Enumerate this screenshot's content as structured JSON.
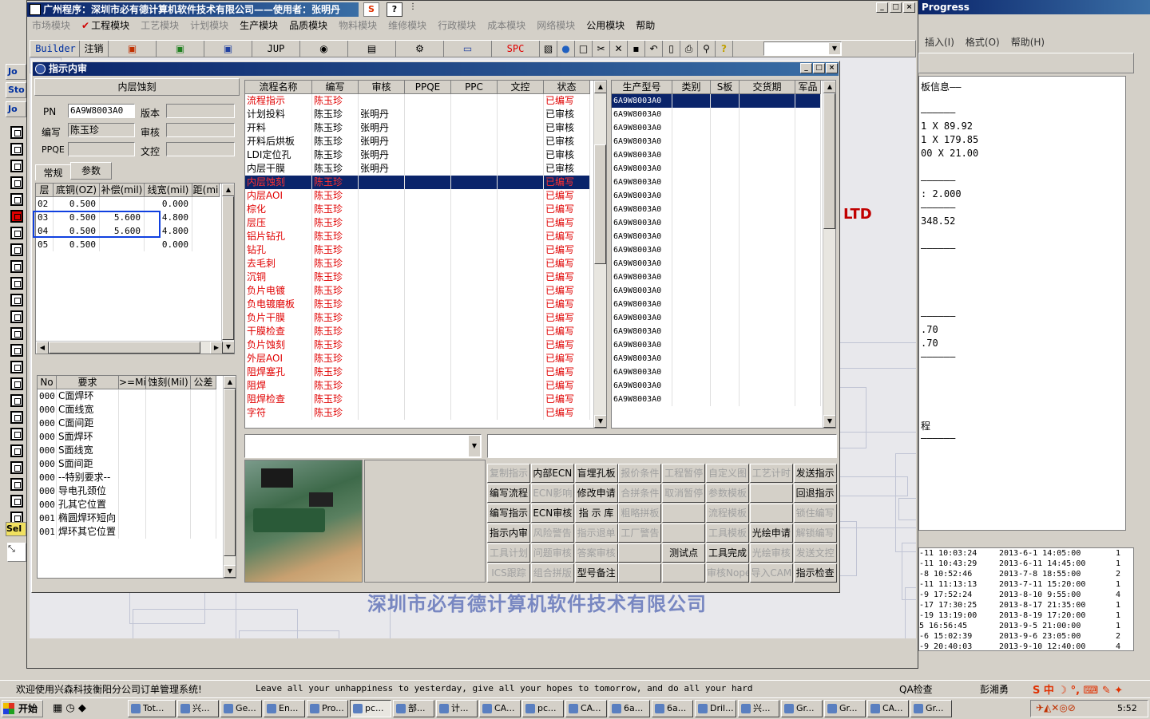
{
  "bg_app": {
    "title": "Progress",
    "menu": [
      "插入(I)",
      "格式(O)",
      "帮助(H)"
    ],
    "doc_lines": [
      "板信息——",
      "",
      "——————",
      "1 X 89.92",
      "1 X 179.85",
      "00 X 21.00",
      "",
      "——————",
      ": 2.000",
      "——————",
      "348.52",
      "",
      "——————",
      "",
      "",
      "",
      "",
      "——————",
      ".70",
      ".70",
      "——————",
      "",
      "",
      "",
      "",
      "程",
      "——————"
    ],
    "table_rows": [
      [
        "-11 10:03:24",
        "2013-6-1 14:05:00",
        "1"
      ],
      [
        "-11 10:43:29",
        "2013-6-11 14:45:00",
        "1"
      ],
      [
        "-8 10:52:46",
        "2013-7-8 18:55:00",
        "2"
      ],
      [
        "-11 11:13:13",
        "2013-7-11 15:20:00",
        "1"
      ],
      [
        "-9 17:52:24",
        "2013-8-10 9:55:00",
        "4"
      ],
      [
        "-17 17:30:25",
        "2013-8-17 21:35:00",
        "1"
      ],
      [
        "-19 13:19:00",
        "2013-8-19 17:20:00",
        "1"
      ],
      [
        "5 16:56:45",
        "2013-9-5 21:00:00",
        "1"
      ],
      [
        "-6 15:02:39",
        "2013-9-6 23:05:00",
        "2"
      ],
      [
        "-9 20:40:03",
        "2013-9-10 12:40:00",
        "4"
      ]
    ]
  },
  "main": {
    "title": "广州程序：深圳市必有德计算机软件技术有限公司——使用者：张明丹",
    "menu": [
      "市场模块",
      "工程模块",
      "工艺模块",
      "计划模块",
      "生产模块",
      "品质模块",
      "物料模块",
      "维修模块",
      "行政模块",
      "成本模块",
      "网络模块",
      "公用模块",
      "帮助"
    ],
    "toolbar": {
      "builder": "Builder",
      "logout": "注销",
      "jup": "JUP",
      "spc": "SPC"
    },
    "company": "深圳市必有德计算机软件技术有限公司",
    "ltd": "LTD"
  },
  "left_strip": [
    "Jo",
    "Sto",
    "Jo",
    "Sel"
  ],
  "dialog": {
    "title": "指示内审",
    "section": "内层蚀刻",
    "pn_label": "PN",
    "pn": "6A9W8003A0",
    "version_label": "版本",
    "writer_label": "编写",
    "writer": "陈玉珍",
    "reviewer_label": "审核",
    "ppqe_label": "PPQE",
    "doc_label": "文控",
    "tabs": [
      "常规",
      "参数"
    ],
    "layer_headers": [
      "层",
      "底铜(OZ)",
      "补偿(mil)",
      "线宽(mil)",
      "距(mi"
    ],
    "layers": [
      [
        "02",
        "0.500",
        "",
        "0.000"
      ],
      [
        "03",
        "0.500",
        "5.600",
        "4.800"
      ],
      [
        "04",
        "0.500",
        "5.600",
        "4.800"
      ],
      [
        "05",
        "0.500",
        "",
        "0.000"
      ]
    ],
    "req_headers": [
      "No",
      "要求",
      ">=Mil",
      "蚀刻(Mil)",
      "公差"
    ],
    "reqs": [
      [
        "000",
        "C面焊环"
      ],
      [
        "000",
        "C面线宽"
      ],
      [
        "000",
        "C面间距"
      ],
      [
        "000",
        "S面焊环"
      ],
      [
        "000",
        "S面线宽"
      ],
      [
        "000",
        "S面间距"
      ],
      [
        "000",
        "--特别要求--"
      ],
      [
        "000",
        "导电孔颈位"
      ],
      [
        "000",
        "孔其它位置"
      ],
      [
        "001",
        "椭圆焊环短向"
      ],
      [
        "001",
        "焊环其它位置"
      ]
    ],
    "flow_headers": [
      "流程名称",
      "编写",
      "审核",
      "PPQE",
      "PPC",
      "文控",
      "状态"
    ],
    "flows": [
      [
        "流程指示",
        "陈玉珍",
        "",
        "已编写",
        "red"
      ],
      [
        "计划投料",
        "陈玉珍",
        "张明丹",
        "已审核",
        ""
      ],
      [
        "开料",
        "陈玉珍",
        "张明丹",
        "已审核",
        ""
      ],
      [
        "开料后烘板",
        "陈玉珍",
        "张明丹",
        "已审核",
        ""
      ],
      [
        "LDI定位孔",
        "陈玉珍",
        "张明丹",
        "已审核",
        ""
      ],
      [
        "内层干膜",
        "陈玉珍",
        "张明丹",
        "已审核",
        ""
      ],
      [
        "内层蚀刻",
        "陈玉珍",
        "",
        "已编写",
        "sel"
      ],
      [
        "内层AOI",
        "陈玉珍",
        "",
        "已编写",
        "red"
      ],
      [
        "棕化",
        "陈玉珍",
        "",
        "已编写",
        "red"
      ],
      [
        "层压",
        "陈玉珍",
        "",
        "已编写",
        "red"
      ],
      [
        "铝片钻孔",
        "陈玉珍",
        "",
        "已编写",
        "red"
      ],
      [
        "钻孔",
        "陈玉珍",
        "",
        "已编写",
        "red"
      ],
      [
        "去毛刺",
        "陈玉珍",
        "",
        "已编写",
        "red"
      ],
      [
        "沉铜",
        "陈玉珍",
        "",
        "已编写",
        "red"
      ],
      [
        "负片电镀",
        "陈玉珍",
        "",
        "已编写",
        "red"
      ],
      [
        "负电镀磨板",
        "陈玉珍",
        "",
        "已编写",
        "red"
      ],
      [
        "负片干膜",
        "陈玉珍",
        "",
        "已编写",
        "red"
      ],
      [
        "干膜检查",
        "陈玉珍",
        "",
        "已编写",
        "red"
      ],
      [
        "负片蚀刻",
        "陈玉珍",
        "",
        "已编写",
        "red"
      ],
      [
        "外层AOI",
        "陈玉珍",
        "",
        "已编写",
        "red"
      ],
      [
        "阻焊塞孔",
        "陈玉珍",
        "",
        "已编写",
        "red"
      ],
      [
        "阻焊",
        "陈玉珍",
        "",
        "已编写",
        "red"
      ],
      [
        "阻焊检查",
        "陈玉珍",
        "",
        "已编写",
        "red"
      ],
      [
        "字符",
        "陈玉珍",
        "",
        "已编写",
        "red"
      ]
    ],
    "model_headers": [
      "生产型号",
      "类别",
      "S板",
      "交货期",
      "军品"
    ],
    "model_value": "6A9W8003A0",
    "model_rows": 23,
    "buttons": [
      [
        "复制指示",
        "内部ECN",
        "盲埋孔板",
        "报价条件",
        "工程暂停",
        "自定义图",
        "工艺计时",
        "发送指示"
      ],
      [
        "编写流程",
        "ECN影响",
        "修改申请",
        "合拼条件",
        "取消暂停",
        "参数模板",
        "",
        "回退指示"
      ],
      [
        "编写指示",
        "ECN审核",
        "指 示 库",
        "粗略拼板",
        "",
        "流程模板",
        "",
        "锁住编写"
      ],
      [
        "指示内审",
        "风险警告",
        "指示退单",
        "工厂警告",
        "",
        "工具模板",
        "光绘申请",
        "解锁编写"
      ],
      [
        "工具计划",
        "问题审核",
        "答案审核",
        "",
        "测试点",
        "工具完成",
        "光绘审核",
        "发送文控"
      ],
      [
        "ICS跟踪",
        "组合拼版",
        "型号备注",
        "",
        "",
        "审核Nope",
        "导入CAM",
        "指示检查"
      ]
    ],
    "enabled_buttons": [
      "内部ECN",
      "盲埋孔板",
      "发送指示",
      "编写流程",
      "修改申请",
      "回退指示",
      "编写指示",
      "ECN审核",
      "指 示 库",
      "指示内审",
      "光绘申请",
      "工具完成",
      "型号备注",
      "指示检查",
      "测试点"
    ]
  },
  "status": {
    "welcome": "欢迎使用兴森科技衡阳分公司订单管理系统!",
    "marquee": "Leave all your unhappiness to yesterday, give all your hopes to tomorrow, and do all your hard",
    "qa": "QA检查",
    "user": "彭湘勇"
  },
  "taskbar": {
    "start": "开始",
    "tasks": [
      "Tot...",
      "兴...",
      "Ge...",
      "En...",
      "Pro...",
      "pc...",
      "部...",
      "计...",
      "CA...",
      "pc...",
      "CA...",
      "6a...",
      "6a...",
      "Dril...",
      "兴...",
      "Gr...",
      "Gr...",
      "CA...",
      "Gr..."
    ],
    "clock": "5:52"
  }
}
